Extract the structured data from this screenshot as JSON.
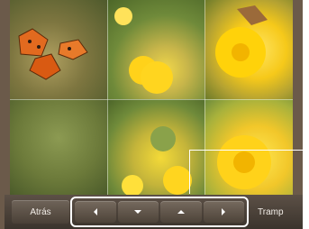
{
  "toolbar": {
    "back_label": "Atrás",
    "trap_label": "Tramp"
  },
  "arrows": [
    {
      "icon": "arrow-left-icon"
    },
    {
      "icon": "arrow-down-icon"
    },
    {
      "icon": "arrow-up-icon"
    },
    {
      "icon": "arrow-right-icon"
    }
  ],
  "colors": {
    "toolbar": "#4a4037",
    "highlight": "#ffffff",
    "frame": "#6b5a4a"
  }
}
